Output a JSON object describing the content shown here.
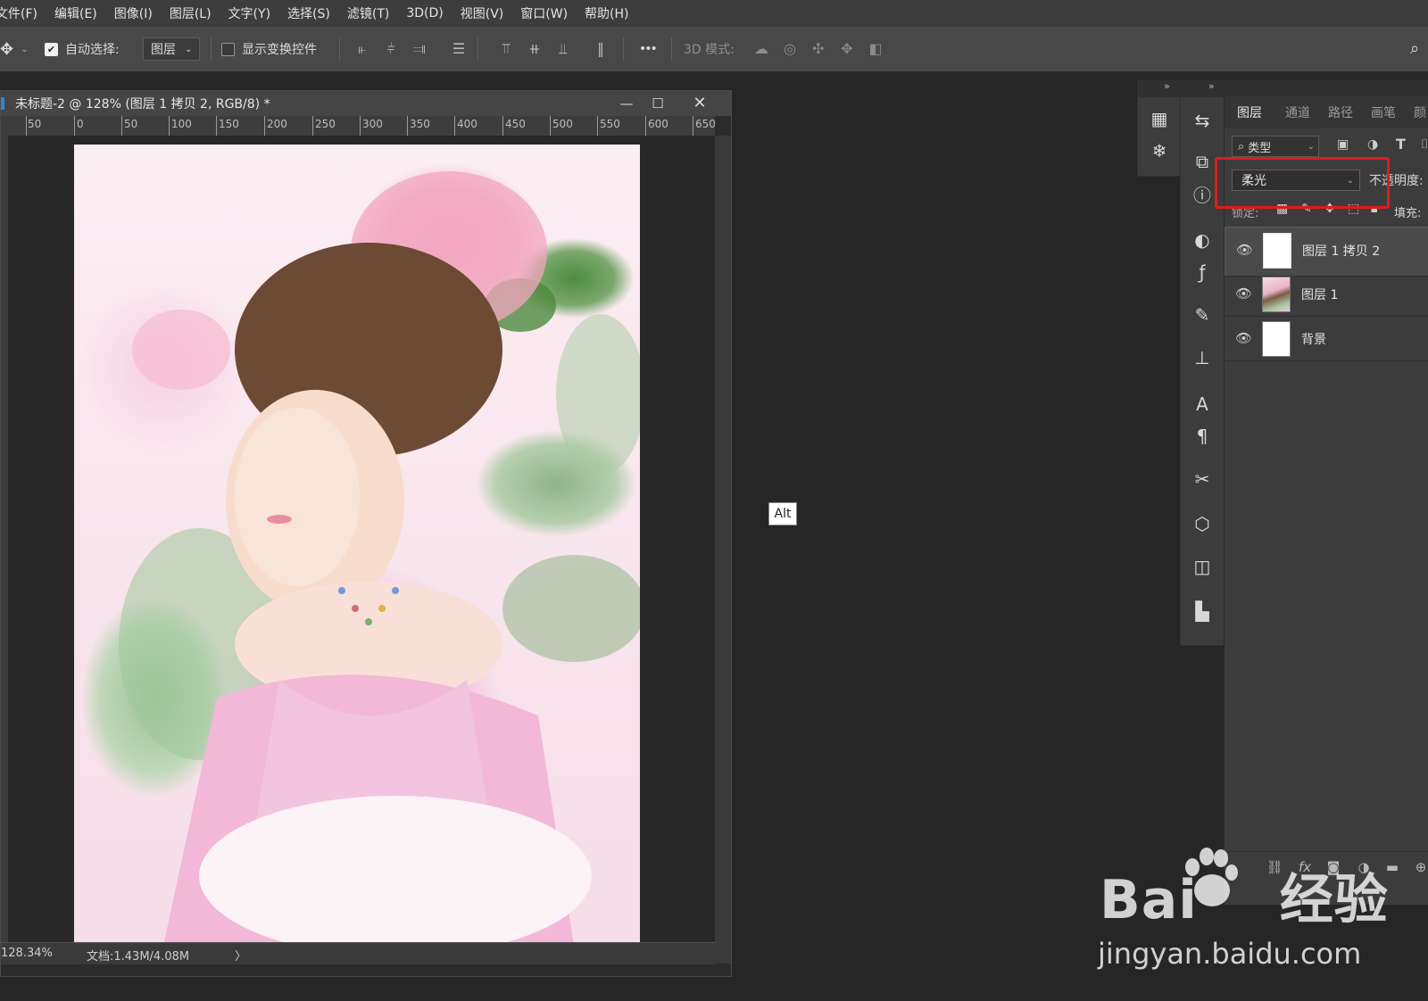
{
  "menu": [
    "文件(F)",
    "编辑(E)",
    "图像(I)",
    "图层(L)",
    "文字(Y)",
    "选择(S)",
    "滤镜(T)",
    "3D(D)",
    "视图(V)",
    "窗口(W)",
    "帮助(H)"
  ],
  "options": {
    "auto_select_label": "自动选择:",
    "auto_select_value": "图层",
    "show_transform_label": "显示变换控件",
    "more_label": "•••",
    "mode_3d_label": "3D 模式:"
  },
  "document": {
    "title": "未标题-2 @ 128% (图层 1 拷贝 2, RGB/8) *",
    "ruler_labels": [
      "50",
      "0",
      "50",
      "100",
      "150",
      "200",
      "250",
      "300",
      "350",
      "400",
      "450",
      "500",
      "550",
      "600",
      "650"
    ],
    "zoom": "128.34%",
    "doc_size": "文档:1.43M/4.08M",
    "status_arrow": "〉"
  },
  "tooltip": "Alt",
  "layers_panel": {
    "tabs": [
      "图层",
      "通道",
      "路径",
      "画笔",
      "颜"
    ],
    "filter_label": "类型",
    "blend_mode": "柔光",
    "opacity_label": "不透明度:",
    "lock_label": "锁定:",
    "fill_label": "填充:",
    "layers": [
      {
        "name": "图层 1 拷贝 2"
      },
      {
        "name": "图层 1"
      },
      {
        "name": "背景"
      }
    ]
  },
  "watermark": {
    "brand": "Bai",
    "brand2": "经验",
    "url": "jingyan.baidu.com"
  },
  "colors": {
    "highlight_box": "#e11b1b",
    "panel_bg": "#3c3c3c",
    "menubar_bg": "#3d3d3d"
  }
}
